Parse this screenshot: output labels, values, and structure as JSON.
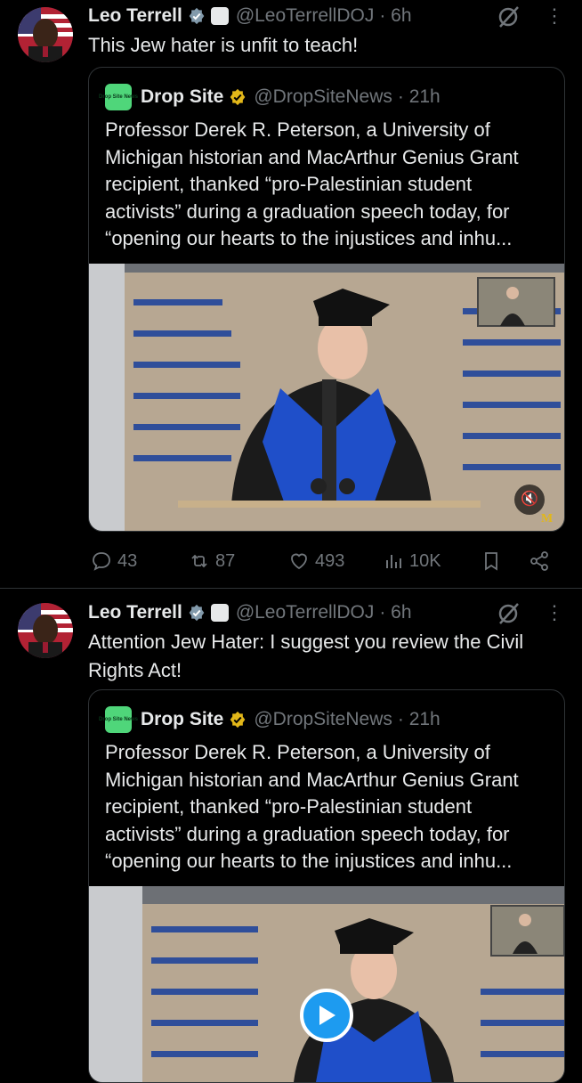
{
  "tweets": [
    {
      "author": "Leo Terrell",
      "handle": "@LeoTerrellDOJ",
      "time": "· 6h",
      "text": "This Jew hater is unfit to teach!",
      "quote": {
        "logo_text": "Drop Site News",
        "author": "Drop Site",
        "handle": "@DropSiteNews",
        "time": "· 21h",
        "text": "Professor Derek R. Peterson, a University of Michigan historian and MacArthur Genius Grant recipient, thanked “pro-Palestinian student activists” during a graduation speech today, for “opening our hearts to the injustices and inhu...",
        "video_state": "muted"
      },
      "actions": {
        "replies": "43",
        "reposts": "87",
        "likes": "493",
        "views": "10K"
      }
    },
    {
      "author": "Leo Terrell",
      "handle": "@LeoTerrellDOJ",
      "time": "· 6h",
      "text": "Attention Jew Hater: I suggest you review the Civil Rights Act!",
      "quote": {
        "logo_text": "Drop Site News",
        "author": "Drop Site",
        "handle": "@DropSiteNews",
        "time": "· 21h",
        "text": "Professor Derek R. Peterson, a University of Michigan historian and MacArthur Genius Grant recipient, thanked “pro-Palestinian student activists” during a graduation speech today, for “opening our hearts to the injustices and inhu...",
        "video_state": "play"
      }
    }
  ],
  "icons": [
    "verified-badge-icon",
    "affiliation-icon",
    "grok-icon",
    "more-icon",
    "reply-icon",
    "repost-icon",
    "like-icon",
    "views-icon",
    "bookmark-icon",
    "share-icon",
    "mute-icon",
    "play-icon"
  ],
  "colors": {
    "background": "#000000",
    "text": "#e7e9ea",
    "muted": "#71767b",
    "accent": "#1d9bf0",
    "gold": "#e2b719"
  }
}
